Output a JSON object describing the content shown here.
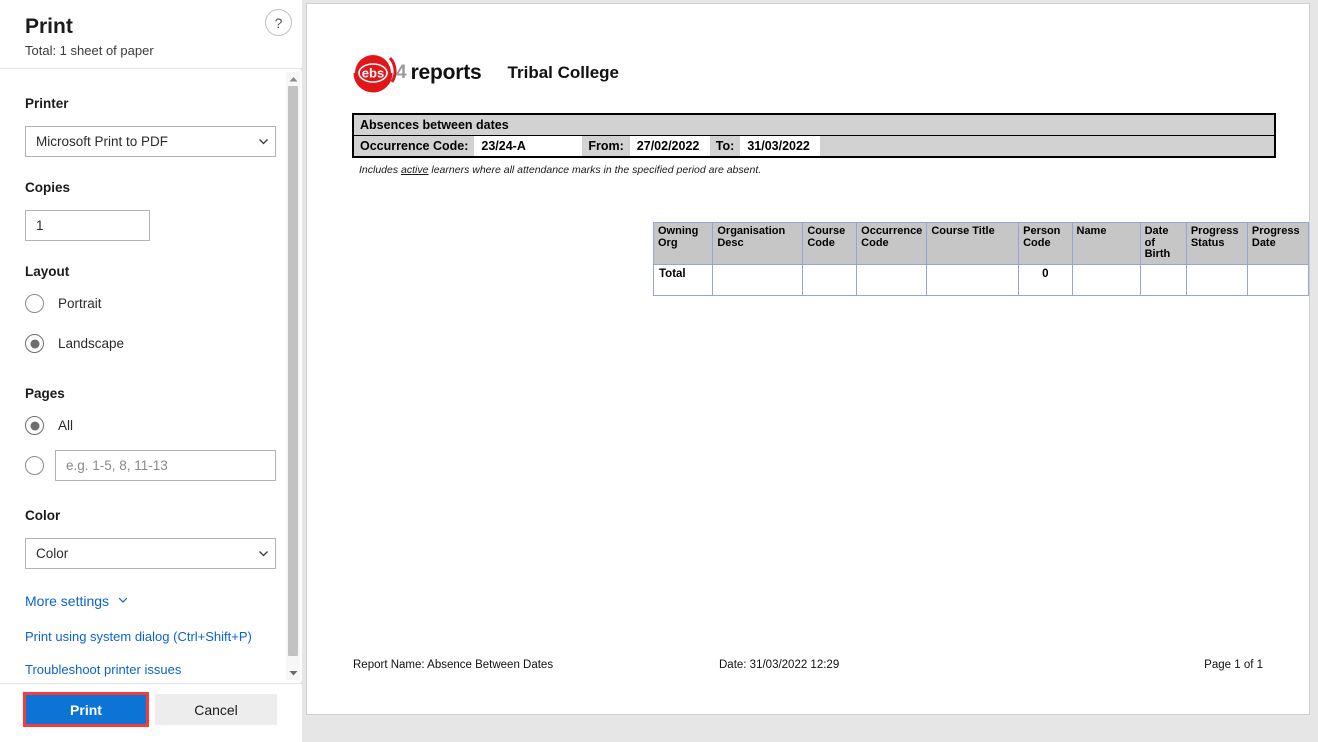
{
  "dialog": {
    "title": "Print",
    "subtitle": "Total: 1 sheet of paper",
    "help_icon_label": "?",
    "printer": {
      "label": "Printer",
      "value": "Microsoft Print to PDF"
    },
    "copies": {
      "label": "Copies",
      "value": "1"
    },
    "layout": {
      "label": "Layout",
      "options": [
        {
          "label": "Portrait",
          "selected": false
        },
        {
          "label": "Landscape",
          "selected": true
        }
      ]
    },
    "pages": {
      "label": "Pages",
      "all_label": "All",
      "all_selected": true,
      "custom_selected": false,
      "custom_placeholder": "e.g. 1-5, 8, 11-13",
      "custom_value": ""
    },
    "color": {
      "label": "Color",
      "value": "Color"
    },
    "links": [
      "More settings",
      "Print using system dialog (Ctrl+Shift+P)",
      "Troubleshoot printer issues"
    ],
    "buttons": {
      "print": "Print",
      "cancel": "Cancel"
    },
    "accent_color": "#0c74d4",
    "highlight_color": "#f73a3a"
  },
  "report": {
    "logo": {
      "badge_text": "ebs",
      "version": "4",
      "product": "reports",
      "badge_color": "#e1161b"
    },
    "organisation": "Tribal College",
    "header": {
      "title": "Absences between dates",
      "occurrence_code_label": "Occurrence Code:",
      "occurrence_code_value": "23/24-A",
      "from_label": "From:",
      "from_value": "27/02/2022",
      "to_label": "To:",
      "to_value": "31/03/2022"
    },
    "note_prefix": "Includes ",
    "note_underlined": "active",
    "note_suffix": " learners where all attendance marks in the specified period are absent.",
    "table": {
      "columns": [
        "Owning Org",
        "Organisation Desc",
        "Course Code",
        "Occurrence Code",
        "Course Title",
        "Person Code",
        "Name",
        "Date of Birth",
        "Progress Status",
        "Progress Date"
      ],
      "rows": [
        {
          "owning_org": "Total",
          "organisation_desc": "",
          "course_code": "",
          "occurrence_code": "",
          "course_title": "",
          "person_code": "0",
          "name": "",
          "date_of_birth": "",
          "progress_status": "",
          "progress_date": ""
        }
      ]
    },
    "footer": {
      "report_name": "Report Name: Absence Between Dates",
      "date": "Date: 31/03/2022 12:29",
      "page": "Page 1 of 1"
    }
  }
}
